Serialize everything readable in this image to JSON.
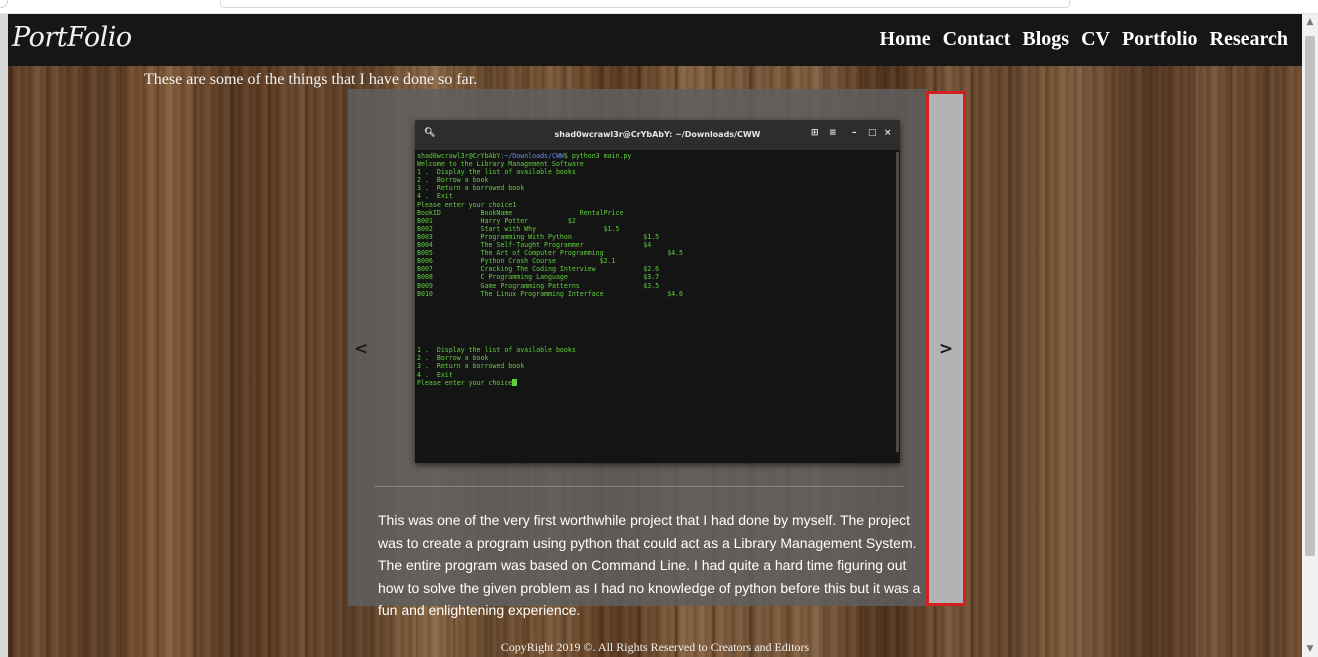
{
  "header": {
    "logo": "PortFolio",
    "nav": [
      "Home",
      "Contact",
      "Blogs",
      "CV",
      "Portfolio",
      "Research"
    ]
  },
  "intro": "These are some of the things that I have done so far.",
  "carousel": {
    "prev_label": "<",
    "next_label": ">",
    "terminal": {
      "title": "shad0wcrawl3r@CrYbAbY: ~/Downloads/CWW",
      "prompt_user": "shad0wcrawl3r@CrYbAbY",
      "prompt_path": ":~/Downloads/CWW",
      "prompt_cmd": "$ python3 main.py",
      "lines_before_table": [
        "Welcome to the Library Management Software",
        "1 .  Display the list of available books",
        "2 .  Borrow a book",
        "3 .  Return a borrowed book",
        "4 .  Exit",
        "Please enter your choice1"
      ],
      "table_header": "BookID          BookName                 RentalPrice",
      "table_rows": [
        "B001            Harry Potter          $2",
        "B002            Start with Why                 $1.5",
        "B003            Programming With Python                  $1.5",
        "B004            The Self-Taught Programmer               $4",
        "B005            The Art of Computer Programming                $4.5",
        "B006            Python Crash Course           $2.1",
        "B007            Cracking The Coding Interview            $2.6",
        "B008            C Programming Language                   $3.7",
        "B009            Game Programming Patterns                $3.5",
        "B010            The Linux Programming Interface                $4.6"
      ],
      "lines_after_table": [
        "1 .  Display the list of available books",
        "2 .  Borrow a book",
        "3 .  Return a borrowed book",
        "4 .  Exit"
      ],
      "final_prompt": "Please enter your choice"
    },
    "description": "This was one of the very first worthwhile project that I had done by myself. The project was to create a program using python that could act as a Library Management System. The entire program was based on Command Line. I had quite a hard time figuring out how to solve the given problem as I had no knowledge of python before this but it was a fun and enlightening experience."
  },
  "footer": "CopyRight 2019 ©. All Rights Reserved to Creators and Editors"
}
